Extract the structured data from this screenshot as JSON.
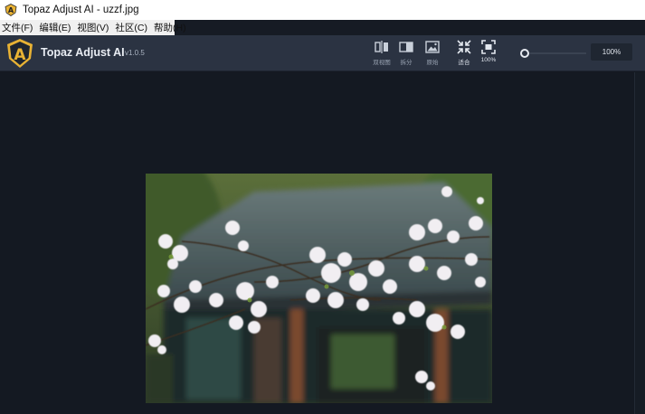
{
  "window": {
    "title": "Topaz Adjust AI - uzzf.jpg"
  },
  "menu": [
    {
      "label": "文件(F)"
    },
    {
      "label": "编辑(E)"
    },
    {
      "label": "视图(V)"
    },
    {
      "label": "社区(C)"
    },
    {
      "label": "帮助(H)"
    }
  ],
  "brand": {
    "name": "Topaz Adjust AI",
    "version": "v1.0.5",
    "logo_letter": "A"
  },
  "toolbar": {
    "view_modes": [
      {
        "label": "双视图",
        "icon": "compare-view-icon"
      },
      {
        "label": "拆分",
        "icon": "split-view-icon"
      },
      {
        "label": "原始",
        "icon": "original-image-icon"
      }
    ],
    "fit": {
      "label": "适合",
      "icon": "fit-screen-icon"
    },
    "actual_size": {
      "label": "100%",
      "icon": "actual-size-icon"
    },
    "zoom_value": "100%",
    "zoom_slider_fraction": 0.0
  },
  "colors": {
    "toolbar_bg": "#2b3342",
    "canvas_bg": "#141922",
    "logo_gold": "#e8b234"
  }
}
